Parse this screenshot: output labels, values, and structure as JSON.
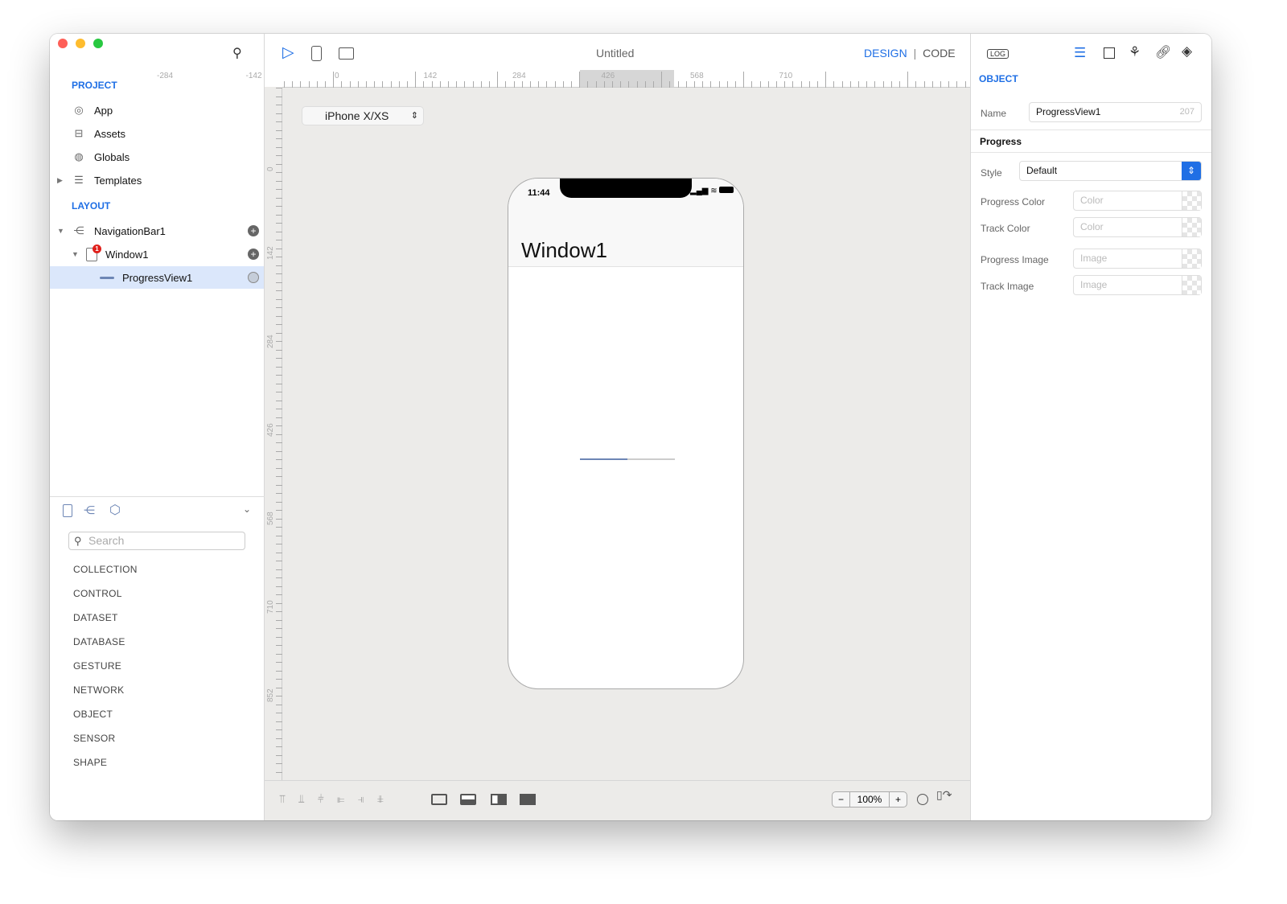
{
  "window": {
    "title": "Untitled"
  },
  "sidebar": {
    "project_header": "PROJECT",
    "project_items": [
      {
        "label": "App",
        "icon": "app-icon"
      },
      {
        "label": "Assets",
        "icon": "briefcase-icon"
      },
      {
        "label": "Globals",
        "icon": "globe-icon"
      },
      {
        "label": "Templates",
        "icon": "templates-icon"
      }
    ],
    "layout_header": "LAYOUT",
    "layout_items": [
      {
        "label": "NavigationBar1",
        "icon": "navigation-bar-icon"
      },
      {
        "label": "Window1",
        "icon": "window-icon",
        "badge": "1"
      },
      {
        "label": "ProgressView1",
        "icon": "progress-view-icon",
        "selected": true
      }
    ],
    "search_placeholder": "Search",
    "categories": [
      "COLLECTION",
      "CONTROL",
      "DATASET",
      "DATABASE",
      "GESTURE",
      "NETWORK",
      "OBJECT",
      "SENSOR",
      "SHAPE"
    ]
  },
  "toolbar": {
    "design": "DESIGN",
    "separator": "|",
    "code": "CODE",
    "device": "iPhone X/XS"
  },
  "ruler": {
    "h_labels": [
      "-284",
      "-142",
      "0",
      "142",
      "284",
      "426",
      "568",
      "710"
    ],
    "v_labels": [
      "0",
      "142",
      "284",
      "426",
      "568",
      "710",
      "852"
    ]
  },
  "phone": {
    "time": "11:44",
    "title": "Window1",
    "progress": 0.5
  },
  "bottom": {
    "zoom": "100%",
    "minus": "−",
    "plus": "+"
  },
  "inspector": {
    "log": "LOG",
    "section": "OBJECT",
    "name_label": "Name",
    "name_value": "ProgressView1",
    "name_id": "207",
    "group": "Progress",
    "style_label": "Style",
    "style_value": "Default",
    "progress_color_label": "Progress Color",
    "track_color_label": "Track Color",
    "color_placeholder": "Color",
    "progress_image_label": "Progress Image",
    "track_image_label": "Track Image",
    "image_placeholder": "Image"
  },
  "colors": {
    "accent": "#1f6fe5",
    "selection": "#dbe7fb"
  }
}
